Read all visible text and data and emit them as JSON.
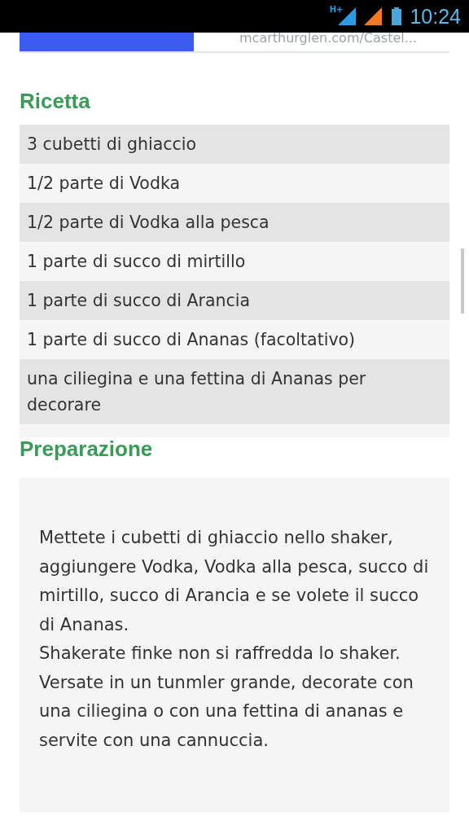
{
  "status_bar": {
    "network": "H+",
    "time": "10:24"
  },
  "ad_banner": {
    "url": "mcarthurglen.com/Castel..."
  },
  "recipe": {
    "title": "Ricetta",
    "ingredients": [
      "3 cubetti di ghiaccio",
      "1/2 parte di Vodka",
      "1/2 parte di Vodka alla pesca",
      "1 parte di succo di mirtillo",
      "1 parte di succo di Arancia",
      "1 parte di succo di Ananas (facoltativo)",
      "una ciliegina e una fettina di Ananas per decorare"
    ]
  },
  "preparation": {
    "title": "Preparazione",
    "paragraphs": [
      "Mettete i cubetti di ghiaccio nello shaker, aggiungere Vodka, Vodka alla pesca, succo di mirtillo, succo di Arancia e se volete il succo di Ananas.",
      "Shakerate finke non si raffredda lo shaker. Versate in un tunmler grande, decorate con una ciliegina o con una fettina di ananas e servite con una cannuccia."
    ]
  }
}
